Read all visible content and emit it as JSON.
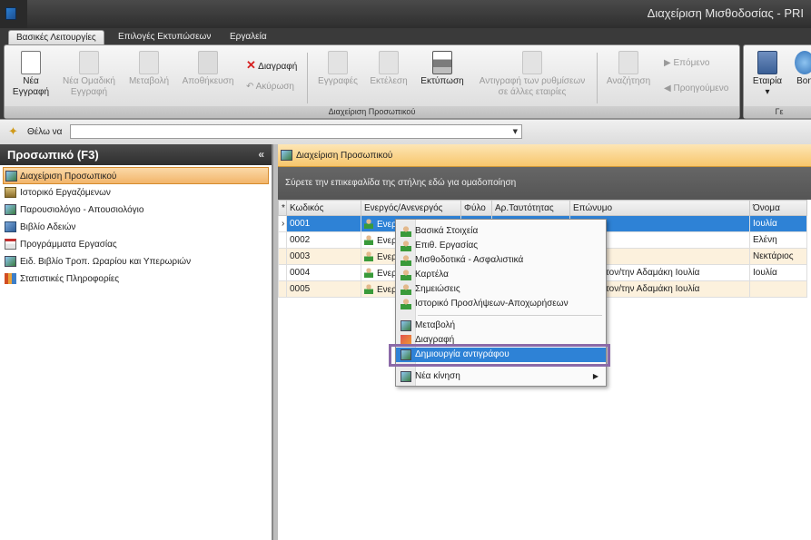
{
  "window": {
    "title": "Διαχείριση Μισθοδοσίας - PRI"
  },
  "tabs": [
    {
      "label": "Βασικές Λειτουργίες",
      "active": true
    },
    {
      "label": "Επιλογές Εκτυπώσεων",
      "active": false
    },
    {
      "label": "Εργαλεία",
      "active": false
    }
  ],
  "ribbon": {
    "group_label": "Διαχείριση Προσωπικού",
    "group2_label": "Γε",
    "new_record": {
      "line1": "Νέα",
      "line2": "Εγγραφή"
    },
    "new_group_record": {
      "line1": "Νέα Ομαδική",
      "line2": "Εγγραφή"
    },
    "edit": "Μεταβολή",
    "save": "Αποθήκευση",
    "delete": "Διαγραφή",
    "cancel": "Ακύρωση",
    "records": "Εγγραφές",
    "execute": "Εκτέλεση",
    "print": "Εκτύπωση",
    "copy_settings": {
      "line1": "Αντιγραφή των ρυθμίσεων",
      "line2": "σε άλλες εταιρίες"
    },
    "search": "Αναζήτηση",
    "next": "Επόμενο",
    "previous": "Προηγούμενο",
    "company": "Εταιρία",
    "cut": "Βοη"
  },
  "thelo": {
    "label": "Θέλω να",
    "value": ""
  },
  "left_pane": {
    "title": "Προσωπικό   (F3)",
    "collapse": "«",
    "items": [
      {
        "label": "Διαχείριση Προσωπικού",
        "icon": "grid-icon",
        "selected": true
      },
      {
        "label": "Ιστορικό Εργαζόμενων",
        "icon": "history-icon",
        "selected": false
      },
      {
        "label": "Παρουσιολόγιο - Απουσιολόγιο",
        "icon": "grid-icon",
        "selected": false
      },
      {
        "label": "Βιβλίο Αδειών",
        "icon": "image-icon",
        "selected": false
      },
      {
        "label": "Προγράμματα Εργασίας",
        "icon": "calendar-icon",
        "selected": false
      },
      {
        "label": "Ειδ. Βιβλίο Τροπ. Ωραρίου και Υπερωριών",
        "icon": "edit-icon",
        "selected": false
      },
      {
        "label": "Στατιστικές Πληροφορίες",
        "icon": "stats-icon",
        "selected": false
      }
    ]
  },
  "right_pane": {
    "title": "Διαχείριση Προσωπικού",
    "group_hint": "Σύρετε την επικεφαλίδα της στήλης εδώ για ομαδοποίηση",
    "columns": [
      "*",
      "Κωδικός",
      "Ενεργός/Ανενεργός",
      "Φύλο",
      "Αρ.Ταυτότητας",
      "Επώνυμο",
      "Όνομα"
    ],
    "rows": [
      {
        "marker": "›",
        "code": "0001",
        "active": "Ενερ",
        "gender": "",
        "id": "",
        "surname": "",
        "name": "Ιουλία"
      },
      {
        "marker": "",
        "code": "0002",
        "active": "Ενερ",
        "gender": "",
        "id": "",
        "surname": "μα",
        "name": "Ελένη"
      },
      {
        "marker": "",
        "code": "0003",
        "active": "Ενερ",
        "gender": "",
        "id": "",
        "surname": "",
        "name": "Νεκτάριος"
      },
      {
        "marker": "",
        "code": "0004",
        "active": "Ενερ",
        "gender": "",
        "id": "",
        "surname": "φή από τον/την Αδαμάκη  Ιουλία",
        "name": "Ιουλία"
      },
      {
        "marker": "",
        "code": "0005",
        "active": "Ενερ",
        "gender": "",
        "id": "",
        "surname": "φή από τον/την Αδαμάκη  Ιουλία",
        "name": ""
      }
    ]
  },
  "context_menu": {
    "items": [
      {
        "label": "Βασικά Στοιχεία"
      },
      {
        "label": "Επιθ. Εργασίας"
      },
      {
        "label": "Μισθοδοτικά - Ασφαλιστικά"
      },
      {
        "label": "Καρτέλα"
      },
      {
        "label": "Σημειώσεις"
      },
      {
        "label": "Ιστορικό Προσλήψεων-Αποχωρήσεων"
      }
    ],
    "edit": "Μεταβολή",
    "delete": "Διαγραφή",
    "duplicate": "Δημιουργία αντιγράφου",
    "new_movement": "Νέα κίνηση",
    "submenu_arrow": "▶"
  },
  "colors": {
    "accent": "#2e82d6",
    "highlight_box": "#8b6aa8",
    "header_orange": "#f7c66c"
  }
}
